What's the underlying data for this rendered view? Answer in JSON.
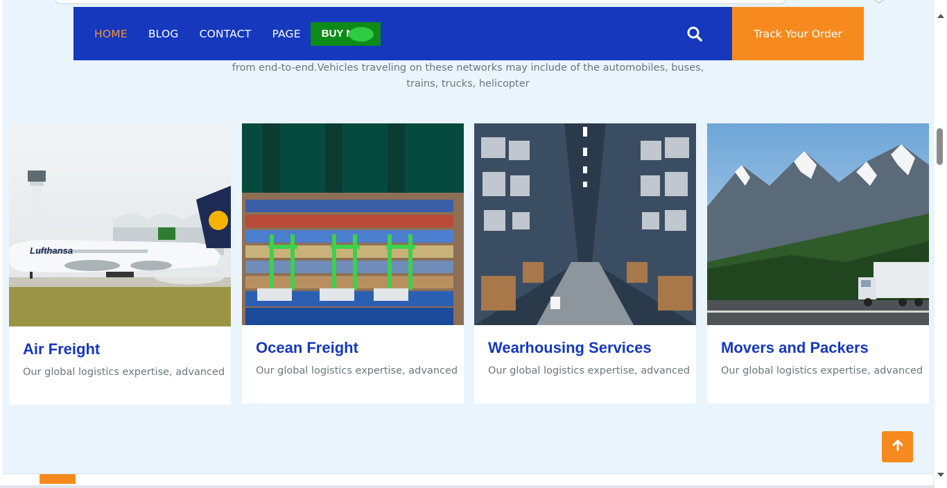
{
  "nav": {
    "items": [
      {
        "label": "HOME",
        "active": true
      },
      {
        "label": "BLOG",
        "active": false
      },
      {
        "label": "CONTACT",
        "active": false
      },
      {
        "label": "PAGE",
        "active": false
      }
    ],
    "buy_label": "BUY N",
    "search_icon": "search-icon",
    "track_label": "Track Your Order"
  },
  "intro": {
    "text_line1": "from end-to-end.Vehicles traveling on these networks may include of the automobiles, buses,",
    "text_line2": "trains, trucks, helicopter"
  },
  "services": [
    {
      "title": "Air Freight",
      "description": "Our global logistics expertise, advanced",
      "image": "airplane-photo"
    },
    {
      "title": "Ocean Freight",
      "description": "Our global logistics expertise, advanced",
      "image": "container-port-photo"
    },
    {
      "title": "Wearhousing Services",
      "description": "Our global logistics expertise, advanced",
      "image": "warehouse-photo"
    },
    {
      "title": "Movers and Packers",
      "description": "Our global logistics expertise, advanced",
      "image": "mountain-truck-photo"
    }
  ],
  "colors": {
    "nav_bg": "#1538bd",
    "accent": "#f68a1e",
    "buy_bg": "#0e8a19",
    "page_bg": "#e9f4fd",
    "title_color": "#1538bd"
  },
  "scroll_top_icon": "arrow-up-icon"
}
